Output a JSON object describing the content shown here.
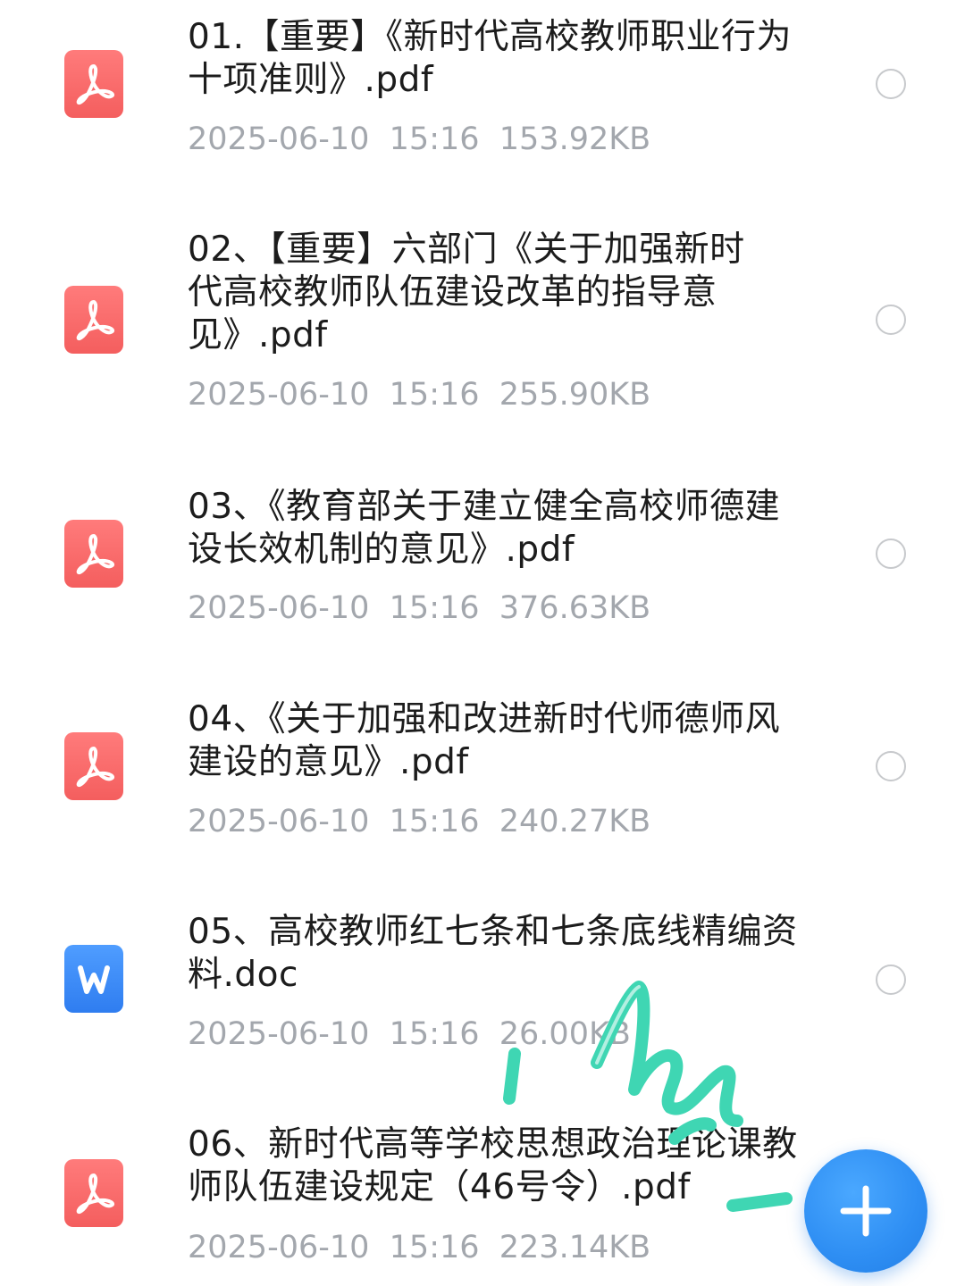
{
  "icons": {
    "pdf": "pdf-icon",
    "doc": "word-doc-icon",
    "select": "radio-circle-icon",
    "add": "plus-icon"
  },
  "colors": {
    "pdf_red": "#f45e5e",
    "doc_blue": "#2f7df0",
    "fab_blue": "#2e8ef3",
    "meta_gray": "#a3a7ad",
    "scribble_teal": "#3fd6b3"
  },
  "files": [
    {
      "type": "pdf",
      "name": "01.【重要】《新时代高校教师职业行为十项准则》.pdf",
      "date": "2025-06-10",
      "time": "15:16",
      "size": "153.92KB",
      "meta": "2025-06-10  15:16  153.92KB"
    },
    {
      "type": "pdf",
      "name": "02、【重要】六部门《关于加强新时代高校教师队伍建设改革的指导意见》.pdf",
      "date": "2025-06-10",
      "time": "15:16",
      "size": "255.90KB",
      "meta": "2025-06-10  15:16  255.90KB"
    },
    {
      "type": "pdf",
      "name": "03、《教育部关于建立健全高校师德建设长效机制的意见》.pdf",
      "date": "2025-06-10",
      "time": "15:16",
      "size": "376.63KB",
      "meta": "2025-06-10  15:16  376.63KB"
    },
    {
      "type": "pdf",
      "name": "04、《关于加强和改进新时代师德师风建设的意见》.pdf",
      "date": "2025-06-10",
      "time": "15:16",
      "size": "240.27KB",
      "meta": "2025-06-10  15:16  240.27KB"
    },
    {
      "type": "doc",
      "name": "05、高校教师红七条和七条底线精编资料.doc",
      "date": "2025-06-10",
      "time": "15:16",
      "size": "26.00KB",
      "meta": "2025-06-10  15:16  26.00KB"
    },
    {
      "type": "pdf",
      "name": "06、新时代高等学校思想政治理论课教师队伍建设规定（46号令）.pdf",
      "date": "2025-06-10",
      "time": "15:16",
      "size": "223.14KB",
      "meta": "2025-06-10  15:16  223.14KB"
    }
  ]
}
